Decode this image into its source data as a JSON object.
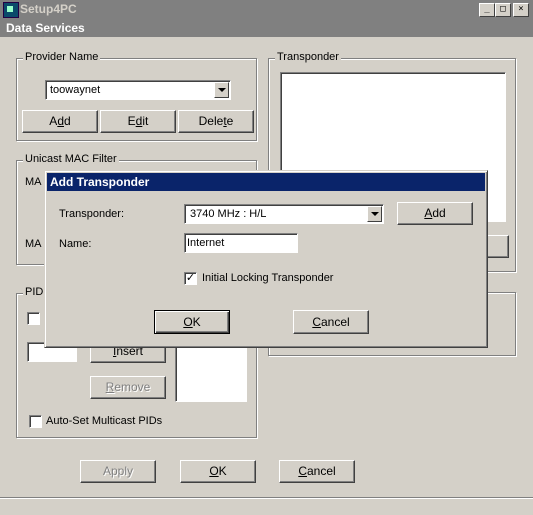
{
  "window": {
    "title": "Setup4PC",
    "minimize_glyph": "_",
    "maximize_glyph": "□",
    "close_glyph": "×"
  },
  "header": {
    "title": "Data Services"
  },
  "provider": {
    "legend": "Provider Name",
    "selected": "toowaynet",
    "add_prefix": "A",
    "add_mnemonic": "d",
    "add_suffix": "d",
    "edit_prefix": "E",
    "edit_mnemonic": "d",
    "edit_suffix": "it",
    "delete_prefix": "Dele",
    "delete_mnemonic": "t",
    "delete_suffix": "e"
  },
  "unicast": {
    "legend": "Unicast MAC Filter",
    "label1_partial": "MA",
    "label2_partial": "MA"
  },
  "pid": {
    "legend_partial": "PID",
    "insert_mnemonic": "I",
    "insert_suffix": "nsert",
    "remove_mnemonic": "R",
    "remove_suffix": "emove",
    "auto_set_label": "Auto-Set Multicast PIDs",
    "auto_set_checked": false
  },
  "transponder_group": {
    "legend": "Transponder"
  },
  "footer": {
    "apply_label": "Apply",
    "ok_mnemonic": "O",
    "ok_suffix": "K",
    "cancel_mnemonic": "C",
    "cancel_suffix": "ancel"
  },
  "dialog": {
    "title": "Add Transponder",
    "transponder_label": "Transponder:",
    "transponder_value": "3740 MHz  :  H/L",
    "add_mnemonic": "A",
    "add_suffix": "dd",
    "name_label": "Name:",
    "name_value": "Internet",
    "initial_locking_label": "Initial Locking Transponder",
    "initial_locking_checked": true,
    "check_glyph": "✓",
    "ok_mnemonic": "O",
    "ok_suffix": "K",
    "cancel_mnemonic": "C",
    "cancel_suffix": "ancel"
  }
}
